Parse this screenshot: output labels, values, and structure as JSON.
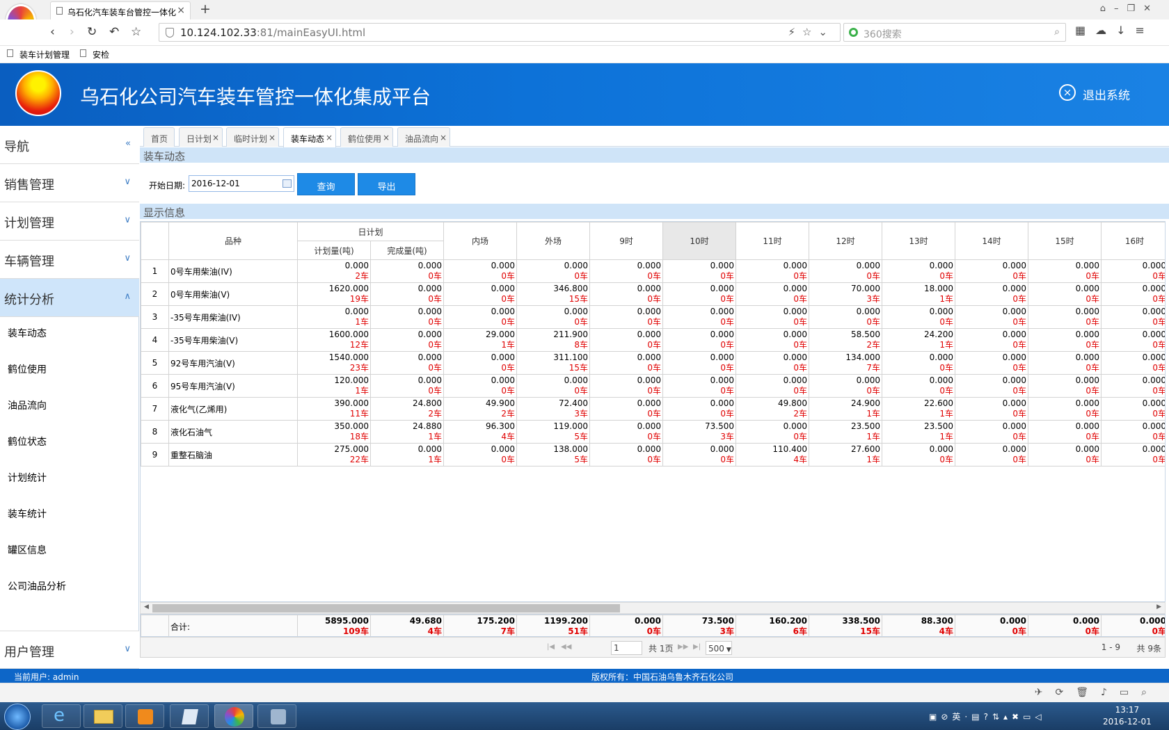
{
  "browser": {
    "tab_title": "乌石化汽车装车台管控一体化",
    "url_host": "10.124.102.33",
    "url_rest": ":81/mainEasyUI.html",
    "search_placeholder": "360搜索",
    "bookmarks": [
      "装车计划管理",
      "安检"
    ]
  },
  "header": {
    "title": "乌石化公司汽车装车管控一体化集成平台",
    "logout": "退出系统"
  },
  "sidebar": {
    "nav_title": "导航",
    "sections": [
      "销售管理",
      "计划管理",
      "车辆管理",
      "统计分析",
      "用户管理"
    ],
    "items": [
      "装车动态",
      "鹤位使用",
      "油品流向",
      "鹤位状态",
      "计划统计",
      "装车统计",
      "罐区信息",
      "公司油品分析"
    ]
  },
  "tabs": [
    "首页",
    "日计划",
    "临时计划",
    "装车动态",
    "鹤位使用",
    "油品流向"
  ],
  "panel_title": "装车动态",
  "toolbar": {
    "date_label": "开始日期:",
    "date_value": "2016-12-01",
    "query": "查询",
    "export": "导出"
  },
  "grid_title": "显示信息",
  "grid": {
    "h_product": "品种",
    "h_dayplan": "日计划",
    "h_plan": "计划量(吨)",
    "h_done": "完成量(吨)",
    "h_in": "内场",
    "h_out": "外场",
    "hours": [
      "9时",
      "10时",
      "11时",
      "12时",
      "13时",
      "14时",
      "15时",
      "16时"
    ],
    "rows": [
      {
        "no": "1",
        "name": "0号车用柴油(IV)",
        "cells": [
          [
            "0.000",
            "2车"
          ],
          [
            "0.000",
            "0车"
          ],
          [
            "0.000",
            "0车"
          ],
          [
            "0.000",
            "0车"
          ],
          [
            "0.000",
            "0车"
          ],
          [
            "0.000",
            "0车"
          ],
          [
            "0.000",
            "0车"
          ],
          [
            "0.000",
            "0车"
          ],
          [
            "0.000",
            "0车"
          ],
          [
            "0.000",
            "0车"
          ],
          [
            "0.000",
            "0车"
          ],
          [
            "0.000",
            "0车"
          ]
        ]
      },
      {
        "no": "2",
        "name": "0号车用柴油(V)",
        "cells": [
          [
            "1620.000",
            "19车"
          ],
          [
            "0.000",
            "0车"
          ],
          [
            "0.000",
            "0车"
          ],
          [
            "346.800",
            "15车"
          ],
          [
            "0.000",
            "0车"
          ],
          [
            "0.000",
            "0车"
          ],
          [
            "0.000",
            "0车"
          ],
          [
            "70.000",
            "3车"
          ],
          [
            "18.000",
            "1车"
          ],
          [
            "0.000",
            "0车"
          ],
          [
            "0.000",
            "0车"
          ],
          [
            "0.000",
            "0车"
          ]
        ]
      },
      {
        "no": "3",
        "name": "-35号车用柴油(IV)",
        "cells": [
          [
            "0.000",
            "1车"
          ],
          [
            "0.000",
            "0车"
          ],
          [
            "0.000",
            "0车"
          ],
          [
            "0.000",
            "0车"
          ],
          [
            "0.000",
            "0车"
          ],
          [
            "0.000",
            "0车"
          ],
          [
            "0.000",
            "0车"
          ],
          [
            "0.000",
            "0车"
          ],
          [
            "0.000",
            "0车"
          ],
          [
            "0.000",
            "0车"
          ],
          [
            "0.000",
            "0车"
          ],
          [
            "0.000",
            "0车"
          ]
        ]
      },
      {
        "no": "4",
        "name": "-35号车用柴油(V)",
        "cells": [
          [
            "1600.000",
            "12车"
          ],
          [
            "0.000",
            "0车"
          ],
          [
            "29.000",
            "1车"
          ],
          [
            "211.900",
            "8车"
          ],
          [
            "0.000",
            "0车"
          ],
          [
            "0.000",
            "0车"
          ],
          [
            "0.000",
            "0车"
          ],
          [
            "58.500",
            "2车"
          ],
          [
            "24.200",
            "1车"
          ],
          [
            "0.000",
            "0车"
          ],
          [
            "0.000",
            "0车"
          ],
          [
            "0.000",
            "0车"
          ]
        ]
      },
      {
        "no": "5",
        "name": "92号车用汽油(V)",
        "cells": [
          [
            "1540.000",
            "23车"
          ],
          [
            "0.000",
            "0车"
          ],
          [
            "0.000",
            "0车"
          ],
          [
            "311.100",
            "15车"
          ],
          [
            "0.000",
            "0车"
          ],
          [
            "0.000",
            "0车"
          ],
          [
            "0.000",
            "0车"
          ],
          [
            "134.000",
            "7车"
          ],
          [
            "0.000",
            "0车"
          ],
          [
            "0.000",
            "0车"
          ],
          [
            "0.000",
            "0车"
          ],
          [
            "0.000",
            "0车"
          ]
        ]
      },
      {
        "no": "6",
        "name": "95号车用汽油(V)",
        "cells": [
          [
            "120.000",
            "1车"
          ],
          [
            "0.000",
            "0车"
          ],
          [
            "0.000",
            "0车"
          ],
          [
            "0.000",
            "0车"
          ],
          [
            "0.000",
            "0车"
          ],
          [
            "0.000",
            "0车"
          ],
          [
            "0.000",
            "0车"
          ],
          [
            "0.000",
            "0车"
          ],
          [
            "0.000",
            "0车"
          ],
          [
            "0.000",
            "0车"
          ],
          [
            "0.000",
            "0车"
          ],
          [
            "0.000",
            "0车"
          ]
        ]
      },
      {
        "no": "7",
        "name": "液化气(乙烯用)",
        "cells": [
          [
            "390.000",
            "11车"
          ],
          [
            "24.800",
            "2车"
          ],
          [
            "49.900",
            "2车"
          ],
          [
            "72.400",
            "3车"
          ],
          [
            "0.000",
            "0车"
          ],
          [
            "0.000",
            "0车"
          ],
          [
            "49.800",
            "2车"
          ],
          [
            "24.900",
            "1车"
          ],
          [
            "22.600",
            "1车"
          ],
          [
            "0.000",
            "0车"
          ],
          [
            "0.000",
            "0车"
          ],
          [
            "0.000",
            "0车"
          ]
        ]
      },
      {
        "no": "8",
        "name": "液化石油气",
        "cells": [
          [
            "350.000",
            "18车"
          ],
          [
            "24.880",
            "1车"
          ],
          [
            "96.300",
            "4车"
          ],
          [
            "119.000",
            "5车"
          ],
          [
            "0.000",
            "0车"
          ],
          [
            "73.500",
            "3车"
          ],
          [
            "0.000",
            "0车"
          ],
          [
            "23.500",
            "1车"
          ],
          [
            "23.500",
            "1车"
          ],
          [
            "0.000",
            "0车"
          ],
          [
            "0.000",
            "0车"
          ],
          [
            "0.000",
            "0车"
          ]
        ]
      },
      {
        "no": "9",
        "name": "重整石脑油",
        "cells": [
          [
            "275.000",
            "22车"
          ],
          [
            "0.000",
            "1车"
          ],
          [
            "0.000",
            "0车"
          ],
          [
            "138.000",
            "5车"
          ],
          [
            "0.000",
            "0车"
          ],
          [
            "0.000",
            "0车"
          ],
          [
            "110.400",
            "4车"
          ],
          [
            "27.600",
            "1车"
          ],
          [
            "0.000",
            "0车"
          ],
          [
            "0.000",
            "0车"
          ],
          [
            "0.000",
            "0车"
          ],
          [
            "0.000",
            "0车"
          ]
        ]
      }
    ],
    "sum_label": "合计:",
    "sum": [
      [
        "5895.000",
        "109车"
      ],
      [
        "49.680",
        "4车"
      ],
      [
        "175.200",
        "7车"
      ],
      [
        "1199.200",
        "51车"
      ],
      [
        "0.000",
        "0车"
      ],
      [
        "73.500",
        "3车"
      ],
      [
        "160.200",
        "6车"
      ],
      [
        "338.500",
        "15车"
      ],
      [
        "88.300",
        "4车"
      ],
      [
        "0.000",
        "0车"
      ],
      [
        "0.000",
        "0车"
      ],
      [
        "0.000",
        "0车"
      ]
    ]
  },
  "pager": {
    "page": "1",
    "total_pages": "共 1页",
    "page_size": "500",
    "range": "1 - 9",
    "total": "共 9条"
  },
  "status": {
    "user": "当前用户: admin",
    "copyright": "版权所有：中国石油乌鲁木齐石化公司"
  },
  "taskbar": {
    "ime": "英",
    "time": "13:17",
    "date": "2016-12-01"
  },
  "colors": {
    "brand_blue": "#0d66c8",
    "accent_button": "#1e8ae6",
    "count_red": "#e00000",
    "panel_header": "#cfe4f8"
  }
}
